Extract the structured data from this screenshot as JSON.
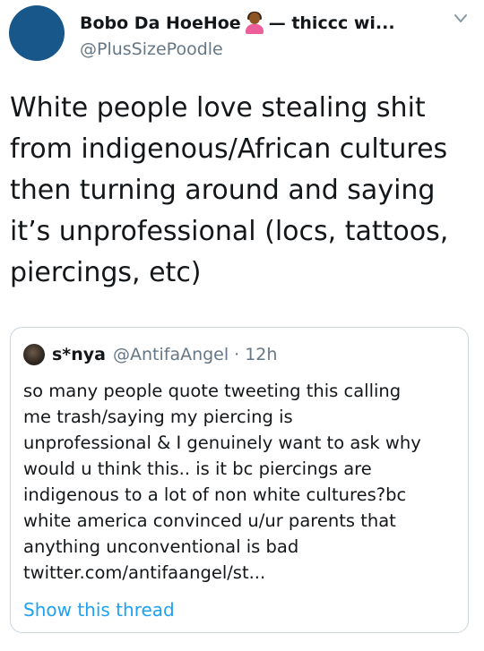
{
  "tweet": {
    "display_name": "Bobo Da HoeHoe",
    "name_suffix": "— thiccc wi...",
    "handle": "@PlusSizePoodle",
    "emoji_icon": "person-gesturing-no-icon",
    "avatar_color": "#18578a",
    "text": "White people love stealing shit from indigenous/African cultures then turning around and saying it’s unprofessional (locs, tattoos, piercings, etc)"
  },
  "quoted_tweet": {
    "display_name": "s*nya",
    "handle": "@AntifaAngel",
    "separator": "·",
    "time": "12h",
    "text_lines": [
      "so many people quote tweeting this calling",
      "me trash/saying my piercing is",
      "unprofessional & I genuinely want to ask why",
      "would u think this.. is it bc piercings are",
      "indigenous to a lot of non white cultures?bc",
      "white america convinced u/ur parents that",
      "anything unconventional is bad",
      "twitter.com/antifaangel/st..."
    ],
    "show_thread_label": "Show this thread"
  },
  "colors": {
    "text": "#14171a",
    "secondary": "#657786",
    "link": "#1da1f2",
    "border": "#ccd6dd"
  }
}
